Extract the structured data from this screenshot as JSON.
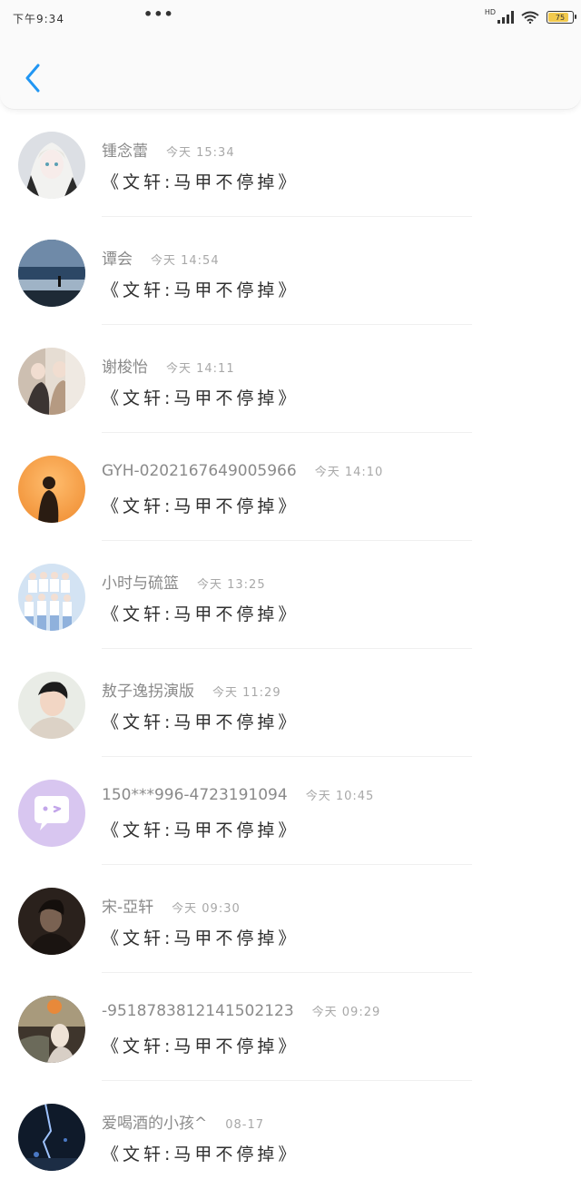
{
  "status_bar": {
    "time": "下午9:34",
    "network": "HD",
    "battery_level": "75"
  },
  "header": {
    "back_icon": "chevron-left-icon",
    "accent": "#2196f3"
  },
  "messages": [
    {
      "name": "锺念蕾",
      "time": "今天 15:34",
      "message": "《文轩:马甲不停掉》",
      "avatar_icon": "anime-portrait-avatar"
    },
    {
      "name": "谭会",
      "time": "今天 14:54",
      "message": "《文轩:马甲不停掉》",
      "avatar_icon": "ocean-photo-avatar"
    },
    {
      "name": "谢梭怡",
      "time": "今天 14:11",
      "message": "《文轩:马甲不停掉》",
      "avatar_icon": "group-photo-avatar"
    },
    {
      "name": "GYH-0202167649005966",
      "time": "今天 14:10",
      "message": "《文轩:马甲不停掉》",
      "avatar_icon": "silhouette-avatar"
    },
    {
      "name": "小时与硫篮",
      "time": "今天 13:25",
      "message": "《文轩:马甲不停掉》",
      "avatar_icon": "boy-band-avatar"
    },
    {
      "name": "敖子逸拐演版",
      "time": "今天 11:29",
      "message": "《文轩:马甲不停掉》",
      "avatar_icon": "portrait-photo-avatar"
    },
    {
      "name": "150***996-4723191094",
      "time": "今天 10:45",
      "message": "《文轩:马甲不停掉》",
      "avatar_icon": "default-chat-avatar"
    },
    {
      "name": "宋-亞轩",
      "time": "今天 09:30",
      "message": "《文轩:马甲不停掉》",
      "avatar_icon": "dark-portrait-avatar"
    },
    {
      "name": "-951878381214150​2123",
      "time": "今天 09:29",
      "message": "《文轩:马甲不停掉》",
      "avatar_icon": "autumn-photo-avatar"
    },
    {
      "name": "爱喝酒的小孩^",
      "time": "08-17",
      "message": "《文轩:马甲不停掉》",
      "avatar_icon": "night-city-avatar"
    }
  ]
}
